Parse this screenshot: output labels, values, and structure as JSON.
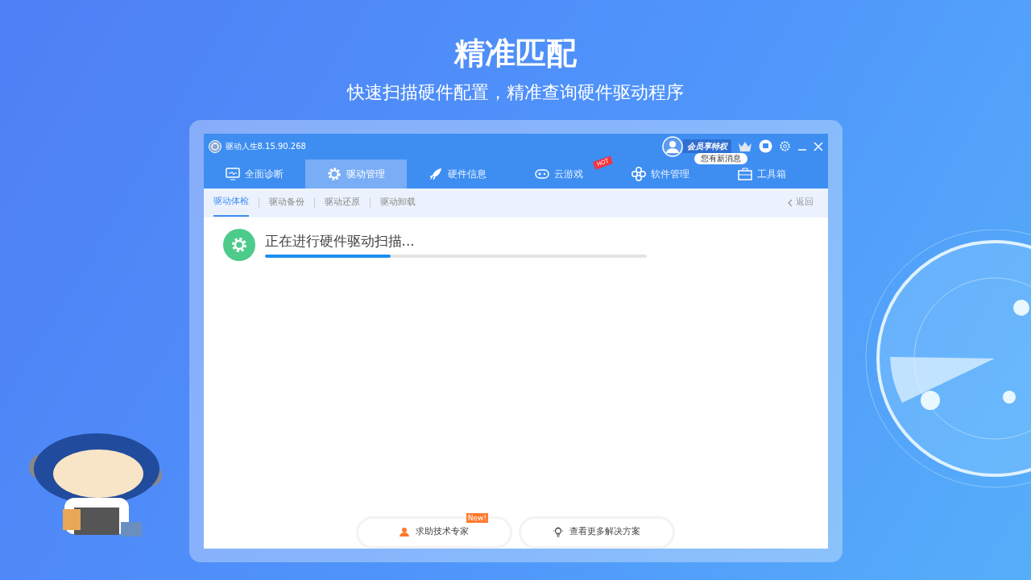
{
  "hero": {
    "title": "精准匹配",
    "subtitle": "快速扫描硬件配置，精准查询硬件驱动程序"
  },
  "window": {
    "title": "驱动人生8.15.90.268",
    "vip_badge": "会员享特权",
    "message_bubble": "您有新消息"
  },
  "tabs": [
    {
      "label": "全面诊断",
      "kind": "monitor",
      "selected": false
    },
    {
      "label": "驱动管理",
      "kind": "gear",
      "selected": true
    },
    {
      "label": "硬件信息",
      "kind": "rocket",
      "selected": false
    },
    {
      "label": "云游戏",
      "kind": "gamepad",
      "selected": false,
      "badge": "HOT"
    },
    {
      "label": "软件管理",
      "kind": "flower",
      "selected": false
    },
    {
      "label": "工具箱",
      "kind": "toolbox",
      "selected": false
    }
  ],
  "subtabs": [
    {
      "label": "驱动体检",
      "selected": true
    },
    {
      "label": "驱动备份",
      "selected": false
    },
    {
      "label": "驱动还原",
      "selected": false
    },
    {
      "label": "驱动卸载",
      "selected": false
    }
  ],
  "back_link": "返回",
  "scan": {
    "status": "正在进行硬件驱动扫描...",
    "level": 0.33
  },
  "buttons": [
    {
      "label": "求助技术专家",
      "kind": "expert",
      "badge": "New!"
    },
    {
      "label": "查看更多解决方案",
      "kind": "solutions"
    }
  ]
}
